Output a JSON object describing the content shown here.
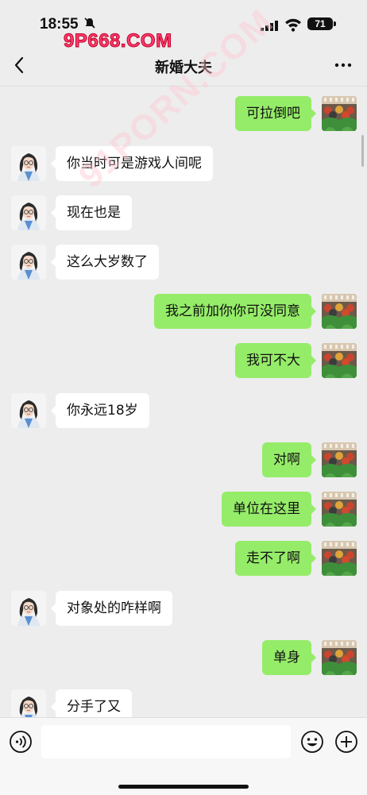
{
  "status_bar": {
    "time": "18:55",
    "battery": "71"
  },
  "watermark": "9P668.COM",
  "diagonal_watermark": "91PORN.COM",
  "nav": {
    "title": "新婚大夫"
  },
  "messages": [
    {
      "side": "right",
      "text": "可拉倒吧"
    },
    {
      "side": "left",
      "text": "你当时可是游戏人间呢"
    },
    {
      "side": "left",
      "text": "现在也是"
    },
    {
      "side": "left",
      "text": "这么大岁数了"
    },
    {
      "side": "right",
      "text": "我之前加你你可没同意"
    },
    {
      "side": "right",
      "text": "我可不大"
    },
    {
      "side": "left",
      "text": "你永远18岁"
    },
    {
      "side": "right",
      "text": "对啊"
    },
    {
      "side": "right",
      "text": "单位在这里"
    },
    {
      "side": "right",
      "text": "走不了啊"
    },
    {
      "side": "left",
      "text": "对象处的咋样啊"
    },
    {
      "side": "right",
      "text": "单身"
    },
    {
      "side": "left",
      "text": "分手了又"
    }
  ],
  "input": {
    "value": ""
  }
}
